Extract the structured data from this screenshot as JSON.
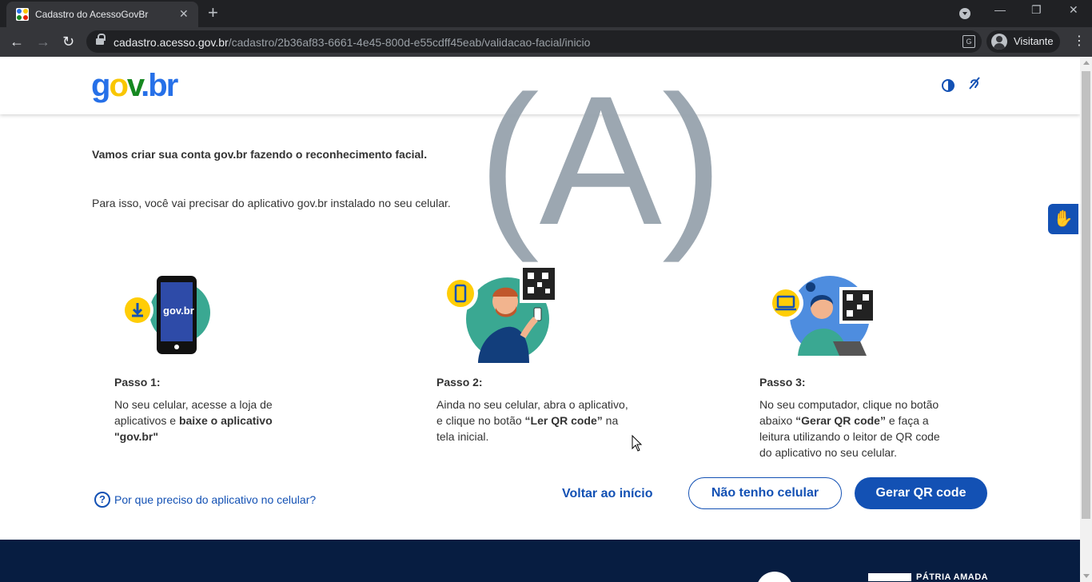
{
  "browser": {
    "tab_title": "Cadastro do AcessoGovBr",
    "url_host": "cadastro.acesso.gov.br",
    "url_path": "/cadastro/2b36af83-6661-4e45-800d-e55cdff45eab/validacao-facial/inicio",
    "profile_label": "Visitante"
  },
  "header": {
    "logo": {
      "g": "g",
      "o": "o",
      "v": "v",
      "dot": ".",
      "br": "br"
    },
    "watermark": "(A)"
  },
  "intro": {
    "title": "Vamos criar sua conta gov.br fazendo o reconhecimento facial.",
    "subtitle": "Para isso, você vai precisar do aplicativo gov.br instalado no seu celular."
  },
  "steps": [
    {
      "title": "Passo 1:",
      "text_a": "No seu celular, acesse a loja de aplicativos e ",
      "text_b": "baixe o aplicativo \"gov.br\"",
      "text_c": "",
      "text_d": "",
      "phone_label": "gov.br"
    },
    {
      "title": "Passo 2:",
      "text_a": "Ainda no seu celular, abra o aplicativo, e clique no botão ",
      "text_b": "“Ler QR code”",
      "text_c": " na tela inicial.",
      "text_d": ""
    },
    {
      "title": "Passo 3:",
      "text_a": "No seu computador, clique no botão abaixo ",
      "text_b": "“Gerar QR code”",
      "text_c": " e faça a leitura utilizando o leitor de QR code do aplicativo no seu celular.",
      "text_d": ""
    }
  ],
  "actions": {
    "help_link": "Por que preciso do aplicativo no celular?",
    "back": "Voltar ao início",
    "no_phone": "Não tenho celular",
    "generate_qr": "Gerar QR code"
  },
  "footer": {
    "text": "PÁTRIA AMADA"
  },
  "colors": {
    "primary": "#1351b4",
    "footer_bg": "#071d41",
    "teal": "#3aa892",
    "yellow": "#ffcd07"
  }
}
